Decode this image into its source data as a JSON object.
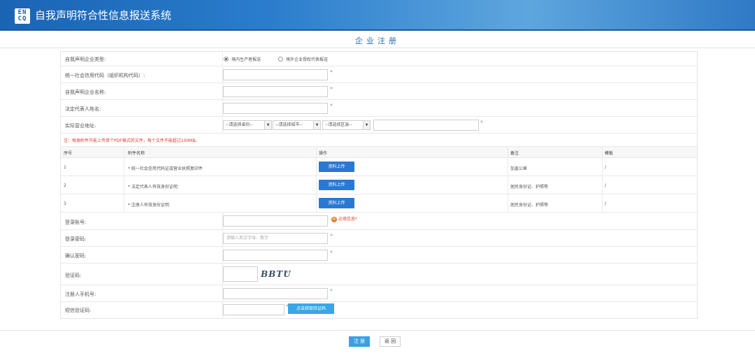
{
  "header": {
    "logo_line1": "EN",
    "logo_line2": "CQ",
    "system_title": "自我声明符合性信息报送系统"
  },
  "page_title": "企业注册",
  "form": {
    "enterprise_type": {
      "label": "自我声明企业类型:",
      "options": [
        "境内生产者报送",
        "境外企业授权代表报送"
      ],
      "selected_index": 0
    },
    "credit_code": {
      "label": "统一社会信用代码（组织机构代码）:",
      "value": "",
      "required": "*"
    },
    "enterprise_name": {
      "label": "自我声明企业名称:",
      "value": "",
      "required": "*"
    },
    "legal_rep": {
      "label": "法定代表人姓名:",
      "value": "",
      "required": "*"
    },
    "address": {
      "label": "实际营业地址:",
      "province": "--请选择省份--",
      "city": "--请选择城市--",
      "district": "--请选择区县--",
      "detail": "",
      "required": "*"
    },
    "upload_notice": "注：每类附件只能上传单个PDF格式的文件，每个文件不能超过100MB。",
    "attachments": {
      "headers": [
        "序号",
        "附件名称",
        "操作",
        "备注",
        "模板"
      ],
      "rows": [
        {
          "no": "1",
          "name": "* 统一社会信用代码证或营业执照复印件",
          "action": "资料上传",
          "remark": "加盖公章",
          "template": "/"
        },
        {
          "no": "2",
          "name": "* 法定代表人有效身份证明",
          "action": "资料上传",
          "remark": "居民身份证、护照等",
          "template": "/"
        },
        {
          "no": "3",
          "name": "* 注册人有效身份证明",
          "action": "资料上传",
          "remark": "居民身份证、护照等",
          "template": "/"
        }
      ]
    },
    "login_account": {
      "label": "登录账号:",
      "value": "",
      "error": "必填信息",
      "required": "*"
    },
    "login_password": {
      "label": "登录密码:",
      "placeholder": "请输入英文字母、数字",
      "required": "*"
    },
    "confirm_password": {
      "label": "确认密码:",
      "value": "",
      "required": "*"
    },
    "captcha": {
      "label": "验证码:",
      "value": "",
      "image_text": "BBTU",
      "required": "*"
    },
    "registrant_phone": {
      "label": "注册人手机号:",
      "value": "",
      "required": "*"
    },
    "sms_code": {
      "label": "短信验证码:",
      "value": "",
      "required": "*",
      "button": "点击获取验证码"
    }
  },
  "buttons": {
    "register": "注 册",
    "back": "返 回"
  },
  "colors": {
    "header": "#1a64b4",
    "primary_button": "#2a78d2",
    "sms_button": "#38a7e6",
    "notice": "#e03a2e"
  }
}
